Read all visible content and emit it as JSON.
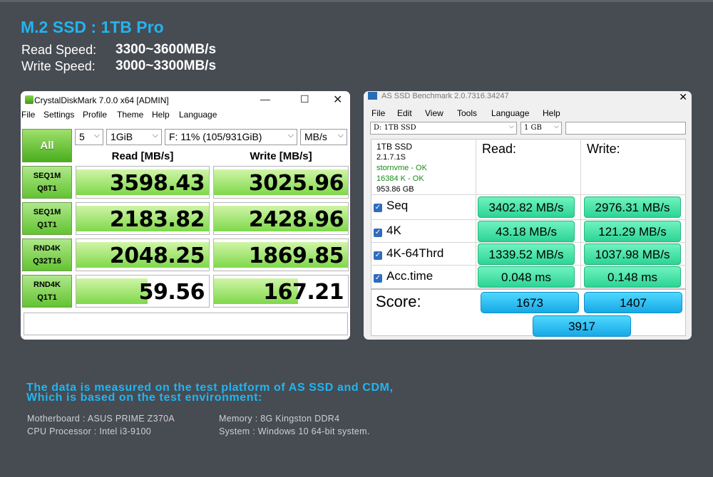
{
  "header": {
    "title": "M.2 SSD :  1TB Pro",
    "read_label": "Read Speed:",
    "read_value": "3300~3600MB/s",
    "write_label": "Write Speed:",
    "write_value": "3000~3300MB/s"
  },
  "cdm": {
    "window_title": "CrystalDiskMark 7.0.0 x64 [ADMIN]",
    "menu": [
      "File",
      "Settings",
      "Profile",
      "Theme",
      "Help",
      "Language"
    ],
    "all_button": "All",
    "count": "5",
    "size": "1GiB",
    "drive": "F: 11% (105/931GiB)",
    "unit": "MB/s",
    "read_header": "Read [MB/s]",
    "write_header": "Write [MB/s]",
    "tests": [
      {
        "line1": "SEQ1M",
        "line2": "Q8T1",
        "read": "3598.43",
        "write": "3025.96",
        "read_fill": 1.0,
        "write_fill": 1.0
      },
      {
        "line1": "SEQ1M",
        "line2": "Q1T1",
        "read": "2183.82",
        "write": "2428.96",
        "read_fill": 1.0,
        "write_fill": 1.0
      },
      {
        "line1": "RND4K",
        "line2": "Q32T16",
        "read": "2048.25",
        "write": "1869.85",
        "read_fill": 1.0,
        "write_fill": 1.0
      },
      {
        "line1": "RND4K",
        "line2": "Q1T1",
        "read": "59.56",
        "write": "167.21",
        "read_fill": 0.54,
        "write_fill": 0.63
      }
    ]
  },
  "asssd": {
    "window_title": "AS SSD Benchmark 2.0.7316.34247",
    "menu": [
      "File",
      "Edit",
      "View",
      "Tools",
      "Language",
      "Help"
    ],
    "drive_select": "D: 1TB SSD",
    "size_select": "1 GB",
    "info": [
      "1TB SSD",
      "2.1.7.1S",
      "stornvme - OK",
      "16384 K - OK",
      "953.86 GB"
    ],
    "read_label": "Read:",
    "write_label": "Write:",
    "rows": [
      {
        "label": "Seq",
        "read": "3402.82 MB/s",
        "write": "2976.31 MB/s"
      },
      {
        "label": "4K",
        "read": "43.18 MB/s",
        "write": "121.29 MB/s"
      },
      {
        "label": "4K-64Thrd",
        "read": "1339.52 MB/s",
        "write": "1037.98 MB/s"
      },
      {
        "label": "Acc.time",
        "read": "0.048 ms",
        "write": "0.148 ms"
      }
    ],
    "score_label": "Score:",
    "score_read": "1673",
    "score_write": "1407",
    "score_total": "3917"
  },
  "footer": {
    "note_line1": "The data is measured on the test platform of AS SSD and CDM,",
    "note_line2": "Which is based on the test environment:",
    "motherboard": "Motherboard : ASUS PRIME Z370A",
    "cpu": "CPU Processor : Intel i3-9100",
    "memory": "Memory : 8G Kingston DDR4",
    "system": "System : Windows 10 64-bit system."
  }
}
